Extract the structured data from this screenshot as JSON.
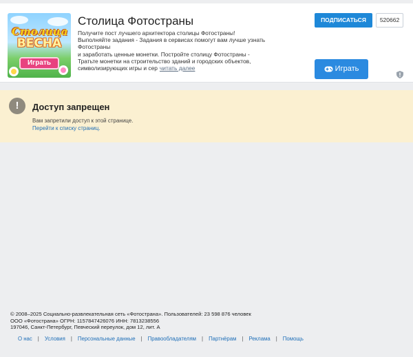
{
  "app": {
    "thumbnail": {
      "logo_top": "Столица",
      "logo_bottom": "ВЕСНА",
      "play_label": "Играть"
    },
    "title": "Столица Фотостраны",
    "description_lines": [
      "Получите пост лучшего архитектора столицы Фотостраны!",
      "Выполняйте задания - Задания в сервисах помогут вам лучше узнать",
      "Фотостраны",
      "и заработать ценные монетки. Постройте столицу Фотостраны -",
      "Тратьте монетки на строительство зданий и городских объектов,",
      "символизирующих игры и сер"
    ],
    "read_more": "читать далее",
    "subscribe_label": "ПОДПИСАТЬСЯ",
    "subscriber_count": "520662",
    "play_label": "Играть",
    "colors": {
      "primary_blue": "#1e88d8",
      "play_blue": "#2b8ae0"
    }
  },
  "error": {
    "icon": "exclamation-icon",
    "title": "Доступ запрещен",
    "message": "Вам запретили доступ к этой странице.",
    "link": "Перейти к списку страниц.",
    "colors": {
      "background": "#fbf0d1"
    }
  },
  "footer": {
    "copyright": "© 2008–2025 Социально-развлекательная сеть «Фотострана». Пользователей: 23 598 876 человек",
    "company": "ООО «Фотострана» ОГРН: 1157847426076 ИНН: 7813238556",
    "address": "197046, Санкт-Петербург, Певческий переулок, дом 12, лит. А",
    "links": [
      "О нас",
      "Условия",
      "Персональные данные",
      "Правообладателям",
      "Партнёрам",
      "Реклама",
      "Помощь"
    ]
  }
}
